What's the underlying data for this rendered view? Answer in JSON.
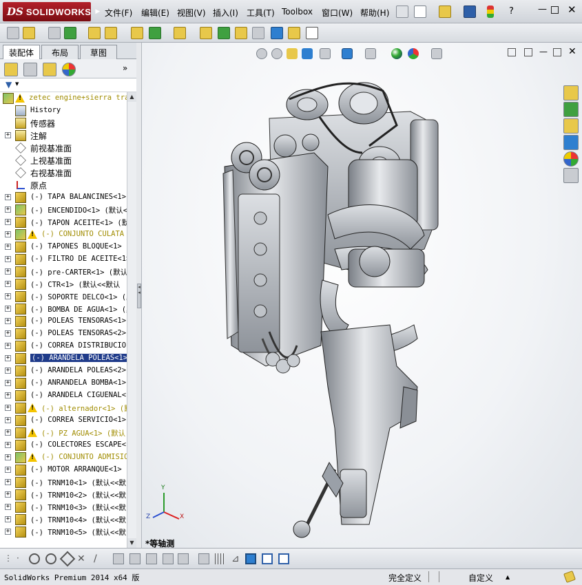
{
  "app": {
    "logo_ds": "DS",
    "logo_name": "SOLIDWORKS"
  },
  "menu": [
    "文件(F)",
    "编辑(E)",
    "视图(V)",
    "插入(I)",
    "工具(T)",
    "Toolbox",
    "窗口(W)",
    "帮助(H)"
  ],
  "tabs": [
    "装配体",
    "布局",
    "草图"
  ],
  "tree": {
    "root": "zetec engine+sierra tran",
    "items": [
      {
        "label": "History",
        "cn": false,
        "expand": false,
        "icon": "history-icon"
      },
      {
        "label": "传感器",
        "cn": true,
        "expand": false,
        "icon": "sensor-icon"
      },
      {
        "label": "注解",
        "cn": true,
        "expand": true,
        "icon": "annotation-icon"
      },
      {
        "label": "前视基准面",
        "cn": true,
        "expand": false,
        "icon": "plane-icon"
      },
      {
        "label": "上视基准面",
        "cn": true,
        "expand": false,
        "icon": "plane-icon"
      },
      {
        "label": "右视基准面",
        "cn": true,
        "expand": false,
        "icon": "plane-icon"
      },
      {
        "label": "原点",
        "cn": true,
        "expand": false,
        "icon": "origin-icon"
      },
      {
        "label": "(-) TAPA BALANCINES<1>",
        "expand": true,
        "icon": "part-icon"
      },
      {
        "label": "(-) ENCENDIDO<1> (默认<",
        "expand": true,
        "icon": "subassembly-icon"
      },
      {
        "label": "(-) TAPON ACEITE<1> (默",
        "expand": true,
        "icon": "part-icon"
      },
      {
        "label": "(-) CONJUNTO CULATA",
        "expand": true,
        "icon": "subassembly-icon",
        "warn": true,
        "yellow": true
      },
      {
        "label": "(-) TAPONES BLOQUE<1> (",
        "expand": true,
        "icon": "part-icon"
      },
      {
        "label": "(-) FILTRO DE ACEITE<1>",
        "expand": true,
        "icon": "part-icon"
      },
      {
        "label": "(-) pre-CARTER<1> (默认",
        "expand": true,
        "icon": "part-icon"
      },
      {
        "label": "(-) CTR<1> (默认<<默认",
        "expand": true,
        "icon": "part-icon"
      },
      {
        "label": "(-) SOPORTE DELCO<1> (默",
        "expand": true,
        "icon": "part-icon"
      },
      {
        "label": "(-) BOMBA DE AGUA<1> (默",
        "expand": true,
        "icon": "part-icon"
      },
      {
        "label": "(-) POLEAS TENSORAS<1>",
        "expand": true,
        "icon": "part-icon"
      },
      {
        "label": "(-) POLEAS TENSORAS<2>",
        "expand": true,
        "icon": "part-icon"
      },
      {
        "label": "(-) CORREA DISTRIBUCIO",
        "expand": true,
        "icon": "part-icon"
      },
      {
        "label": "(-) ARANDELA POLEAS<1>",
        "expand": true,
        "icon": "part-icon",
        "selected": true
      },
      {
        "label": "(-) ARANDELA POLEAS<2>",
        "expand": true,
        "icon": "part-icon"
      },
      {
        "label": "(-) ANRANDELA BOMBA<1>",
        "expand": true,
        "icon": "part-icon"
      },
      {
        "label": "(-) ARANDELA CIGUENAL<1",
        "expand": true,
        "icon": "part-icon"
      },
      {
        "label": "(-) alternador<1> (默",
        "expand": true,
        "icon": "part-icon",
        "warn": true,
        "yellow": true
      },
      {
        "label": "(-) CORREA SERVICIO<1>",
        "expand": true,
        "icon": "part-icon"
      },
      {
        "label": "(-) PZ AGUA<1> (默认",
        "expand": true,
        "icon": "part-icon",
        "warn": true,
        "yellow": true
      },
      {
        "label": "(-) COLECTORES ESCAPE<1",
        "expand": true,
        "icon": "part-icon"
      },
      {
        "label": "(-) CONJUNTO ADMISIO",
        "expand": true,
        "icon": "subassembly-icon",
        "warn": true,
        "yellow": true
      },
      {
        "label": "(-) MOTOR ARRANQUE<1> (",
        "expand": true,
        "icon": "part-icon"
      },
      {
        "label": "(-) TRNM10<1> (默认<<默",
        "expand": true,
        "icon": "part-icon"
      },
      {
        "label": "(-) TRNM10<2> (默认<<默",
        "expand": true,
        "icon": "part-icon"
      },
      {
        "label": "(-) TRNM10<3> (默认<<默",
        "expand": true,
        "icon": "part-icon"
      },
      {
        "label": "(-) TRNM10<4> (默认<<默",
        "expand": true,
        "icon": "part-icon"
      },
      {
        "label": "(-) TRNM10<5> (默认<<默",
        "expand": true,
        "icon": "part-icon"
      }
    ]
  },
  "graphics": {
    "view_label": "*等轴测",
    "triad": {
      "x": "X",
      "y": "Y",
      "z": "Z"
    }
  },
  "status": {
    "version": "SolidWorks Premium 2014 x64 版",
    "definition": "完全定义",
    "units": "自定义",
    "units_arrow": "▲"
  },
  "colors": {
    "accent_red": "#b3202a",
    "selection": "#1f3b8a",
    "warning": "#f4c400",
    "yellow_text": "#a08c00"
  }
}
